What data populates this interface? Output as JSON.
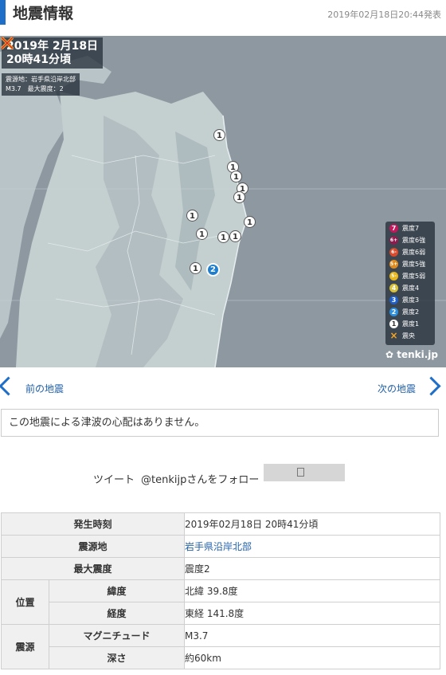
{
  "header": {
    "title": "地震情報",
    "announced": "2019年02月18日20:44発表"
  },
  "map": {
    "date_line": "2019年  2月18日",
    "time_line": "20時41分頃",
    "epicenter_line": "震源地：岩手県沿岸北部",
    "magnitude_line": "M3.7　最大震度：2",
    "pins": [
      "1",
      "1",
      "1",
      "1",
      "1",
      "1",
      "1",
      "1",
      "1",
      "1",
      "1",
      "2"
    ],
    "legend": [
      {
        "symbol": "7",
        "label": "震度7",
        "color": "#c2185b"
      },
      {
        "symbol": "6+",
        "label": "震度6強",
        "color": "#8e1b4e"
      },
      {
        "symbol": "6-",
        "label": "震度6弱",
        "color": "#d84a2b"
      },
      {
        "symbol": "5+",
        "label": "震度5強",
        "color": "#e08a1e"
      },
      {
        "symbol": "5-",
        "label": "震度5弱",
        "color": "#e8b61a"
      },
      {
        "symbol": "4",
        "label": "震度4",
        "color": "#d9c23a"
      },
      {
        "symbol": "3",
        "label": "震度3",
        "color": "#1e5fc9"
      },
      {
        "symbol": "2",
        "label": "震度2",
        "color": "#2d8fe0"
      },
      {
        "symbol": "1",
        "label": "震度1",
        "color": "#ffffff"
      },
      {
        "symbol": "×",
        "label": "震央",
        "color": "#f5a623"
      }
    ],
    "brand": "tenki.jp"
  },
  "nav": {
    "prev": "前の地震",
    "next": "次の地震"
  },
  "tsunami_message": "この地震による津波の心配はありません。",
  "social": {
    "tweet": "ツイート",
    "follow": "@tenkijpさんをフォロー"
  },
  "details": {
    "occurred_label": "発生時刻",
    "occurred": "2019年02月18日 20時41分頃",
    "epicenter_label": "震源地",
    "epicenter": "岩手県沿岸北部",
    "max_intensity_label": "最大震度",
    "max_intensity": "震度2",
    "position_label": "位置",
    "latitude_label": "緯度",
    "latitude": "北緯 39.8度",
    "longitude_label": "経度",
    "longitude": "東経 141.8度",
    "source_label": "震源",
    "magnitude_label": "マグニチュード",
    "magnitude": "M3.7",
    "depth_label": "深さ",
    "depth": "約60km"
  }
}
